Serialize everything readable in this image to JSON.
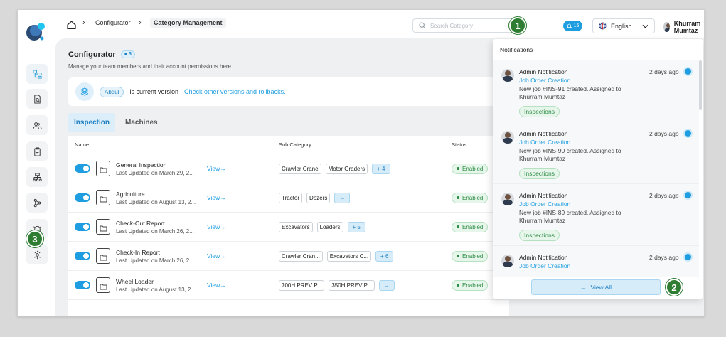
{
  "sidebar": {
    "items": [
      {
        "name": "sidebar-item-dashboard",
        "icon": "hierarchy-icon",
        "active": true
      },
      {
        "name": "sidebar-item-documents",
        "icon": "document-search-icon"
      },
      {
        "name": "sidebar-item-users",
        "icon": "users-icon"
      },
      {
        "name": "sidebar-item-clipboard",
        "icon": "clipboard-icon"
      },
      {
        "name": "sidebar-item-structure",
        "icon": "sitemap-icon"
      },
      {
        "name": "sidebar-item-workflow",
        "icon": "branch-icon"
      },
      {
        "name": "sidebar-item-notifications",
        "icon": "bell-icon"
      },
      {
        "name": "sidebar-item-settings",
        "icon": "gear-icon"
      }
    ]
  },
  "callouts": {
    "one": "1",
    "two": "2",
    "three": "3"
  },
  "header": {
    "breadcrumb": [
      "Configurator",
      "Category Management"
    ],
    "search_placeholder": "Search Category",
    "notif_count": "15",
    "language": "English",
    "user_name": "Khurram Mumtaz"
  },
  "page": {
    "title": "Configurator",
    "title_count": "5",
    "subtitle": "Manage your team members and their account permissions here.",
    "version_tag": "Abdul",
    "version_text": "is current version",
    "version_link": "Check other versions and rollbacks."
  },
  "tabs": [
    "Inspection",
    "Machines"
  ],
  "table": {
    "headers": {
      "name": "Name",
      "sub": "Sub Category",
      "status": "Status"
    },
    "view_label": "View",
    "rows": [
      {
        "name": "General Inspection",
        "updated": "Last Updated on March 29, 2...",
        "chips": [
          "Crawler Crane",
          "Motor Graders"
        ],
        "more": "+ 4",
        "status": "Enabled"
      },
      {
        "name": "Agriculture",
        "updated": "Last Updated on August 13, 2...",
        "chips": [
          "Tractor",
          "Dozers"
        ],
        "more": "→",
        "status": "Enabled"
      },
      {
        "name": "Check-Out Report",
        "updated": "Last Updated on March 26, 2...",
        "chips": [
          "Excavators",
          "Loaders"
        ],
        "more": "+ 5",
        "status": "Enabled"
      },
      {
        "name": "Check-In Report",
        "updated": "Last Updated on March 26, 2...",
        "chips": [
          "Crawler Cran...",
          "Excavators C..."
        ],
        "more": "+ 6",
        "status": "Enabled"
      },
      {
        "name": "Wheel Loader",
        "updated": "Last Updated on August 13, 2...",
        "chips": [
          "700H PREV P...",
          "350H PREV P..."
        ],
        "more": "→",
        "status": "Enabled"
      }
    ]
  },
  "notifications": {
    "title": "Notifications",
    "view_all": "View All",
    "items": [
      {
        "title": "Admin Notification",
        "time": "2 days ago",
        "sub": "Job Order Creation",
        "body": "New job #INS-91 created. Assigned to Khurram Mumtaz",
        "tag": "Inspections"
      },
      {
        "title": "Admin Notification",
        "time": "2 days ago",
        "sub": "Job Order Creation",
        "body": "New job #INS-90 created. Assigned to Khurram Mumtaz",
        "tag": "Inspections"
      },
      {
        "title": "Admin Notification",
        "time": "2 days ago",
        "sub": "Job Order Creation",
        "body": "New job #INS-89 created. Assigned to Khurram Mumtaz",
        "tag": "Inspections"
      },
      {
        "title": "Admin Notification",
        "time": "2 days ago",
        "sub": "Job Order Creation",
        "body": "",
        "tag": ""
      }
    ]
  },
  "colors": {
    "accent": "#1e9ee0",
    "callout": "#2e7d32",
    "enabled": "#2e8b46"
  }
}
